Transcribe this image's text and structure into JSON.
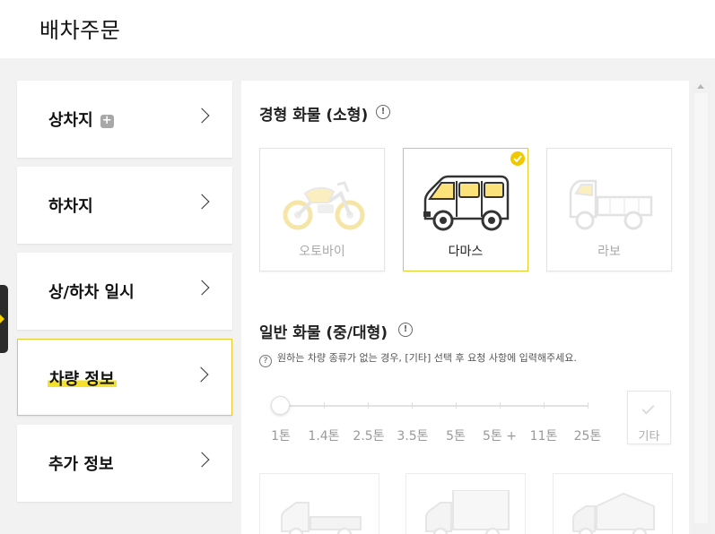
{
  "header": {
    "title": "배차주문"
  },
  "steps": [
    {
      "label": "상차지",
      "has_add_badge": true,
      "add_glyph": "+"
    },
    {
      "label": "하차지"
    },
    {
      "label": "상/하차 일시"
    },
    {
      "label": "차량 정보",
      "active": true
    },
    {
      "label": "추가 정보"
    }
  ],
  "light_cargo": {
    "title": "경형 화물 (소형)",
    "info_glyph": "!",
    "vehicles": [
      {
        "label": "오토바이",
        "icon": "motorcycle-icon",
        "selected": false
      },
      {
        "label": "다마스",
        "icon": "van-icon",
        "selected": true
      },
      {
        "label": "라보",
        "icon": "mini-truck-icon",
        "selected": false
      }
    ]
  },
  "general_cargo": {
    "title": "일반 화물 (중/대형)",
    "info_glyph": "!",
    "help_glyph": "?",
    "help_text": "원하는 차량 종류가 없는 경우, [기타] 선택 후 요청 사항에 입력해주세요.",
    "tonnage": [
      "1톤",
      "1.4톤",
      "2.5톤",
      "3.5톤",
      "5톤",
      "5톤 +",
      "11톤",
      "25톤"
    ],
    "selected_tonnage": "1톤",
    "etc_label": "기타",
    "truck_cards": [
      "cargo-truck-icon",
      "box-truck-icon",
      "covered-truck-icon"
    ]
  },
  "colors": {
    "accent": "#f0c800",
    "highlight": "#f5e02a",
    "border_selected": "#e8cc2c"
  }
}
